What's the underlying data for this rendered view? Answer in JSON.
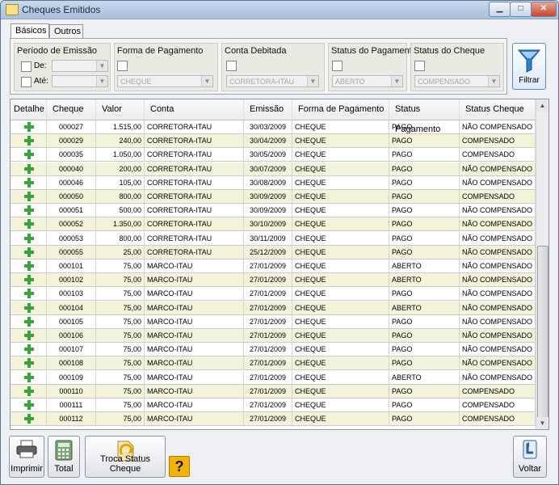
{
  "window": {
    "title": "Cheques Emitidos",
    "minimize": "▁",
    "maximize": "□",
    "close": "✕"
  },
  "tabs": [
    {
      "label": "Básicos"
    },
    {
      "label": "Outros"
    }
  ],
  "filters": {
    "periodo": {
      "label": "Período de Emissão",
      "de_label": "De:",
      "ate_label": "Até:"
    },
    "forma": {
      "label": "Forma de Pagamento",
      "value": "CHEQUE"
    },
    "conta": {
      "label": "Conta Debitada",
      "value": "CORRETORA-ITAU"
    },
    "status_pagamento": {
      "label": "Status do Pagamento",
      "value": "ABERTO"
    },
    "status_cheque": {
      "label": "Status do Cheque",
      "value": "COMPENSADO"
    },
    "filtrar_label": "Filtrar",
    "filtrar_icon": "funnel-icon"
  },
  "grid": {
    "columns": [
      "Detalhe",
      "Cheque",
      "Valor",
      "Conta",
      "Emissão",
      "Forma de Pagamento",
      "Status Pagamento",
      "Status Cheque"
    ],
    "rows": [
      [
        "000027",
        "1.515,00",
        "CORRETORA-ITAU",
        "30/03/2009",
        "CHEQUE",
        "PAGO",
        "NÃO COMPENSADO"
      ],
      [
        "000029",
        "240,00",
        "CORRETORA-ITAU",
        "30/04/2009",
        "CHEQUE",
        "PAGO",
        "COMPENSADO"
      ],
      [
        "000035",
        "1.050,00",
        "CORRETORA-ITAU",
        "30/05/2009",
        "CHEQUE",
        "PAGO",
        "COMPENSADO"
      ],
      [
        "000040",
        "200,00",
        "CORRETORA-ITAU",
        "30/07/2009",
        "CHEQUE",
        "PAGO",
        "NÃO COMPENSADO"
      ],
      [
        "000046",
        "105,00",
        "CORRETORA-ITAU",
        "30/08/2009",
        "CHEQUE",
        "PAGO",
        "NÃO COMPENSADO"
      ],
      [
        "000050",
        "800,00",
        "CORRETORA-ITAU",
        "30/09/2009",
        "CHEQUE",
        "PAGO",
        "COMPENSADO"
      ],
      [
        "000051",
        "500,00",
        "CORRETORA-ITAU",
        "30/09/2009",
        "CHEQUE",
        "PAGO",
        "NÃO COMPENSADO"
      ],
      [
        "000052",
        "1.350,00",
        "CORRETORA-ITAU",
        "30/10/2009",
        "CHEQUE",
        "PAGO",
        "NÃO COMPENSADO"
      ],
      [
        "000053",
        "800,00",
        "CORRETORA-ITAU",
        "30/11/2009",
        "CHEQUE",
        "PAGO",
        "NÃO COMPENSADO"
      ],
      [
        "000055",
        "25,00",
        "CORRETORA-ITAU",
        "25/12/2009",
        "CHEQUE",
        "PAGO",
        "NÃO COMPENSADO"
      ],
      [
        "000101",
        "75,00",
        "MARCO-ITAU",
        "27/01/2009",
        "CHEQUE",
        "ABERTO",
        "NÃO COMPENSADO"
      ],
      [
        "000102",
        "75,00",
        "MARCO-ITAU",
        "27/01/2009",
        "CHEQUE",
        "ABERTO",
        "NÃO COMPENSADO"
      ],
      [
        "000103",
        "75,00",
        "MARCO-ITAU",
        "27/01/2009",
        "CHEQUE",
        "PAGO",
        "NÃO COMPENSADO"
      ],
      [
        "000104",
        "75,00",
        "MARCO-ITAU",
        "27/01/2009",
        "CHEQUE",
        "ABERTO",
        "NÃO COMPENSADO"
      ],
      [
        "000105",
        "75,00",
        "MARCO-ITAU",
        "27/01/2009",
        "CHEQUE",
        "PAGO",
        "NÃO COMPENSADO"
      ],
      [
        "000106",
        "75,00",
        "MARCO-ITAU",
        "27/01/2009",
        "CHEQUE",
        "PAGO",
        "NÃO COMPENSADO"
      ],
      [
        "000107",
        "75,00",
        "MARCO-ITAU",
        "27/01/2009",
        "CHEQUE",
        "PAGO",
        "NÃO COMPENSADO"
      ],
      [
        "000108",
        "75,00",
        "MARCO-ITAU",
        "27/01/2009",
        "CHEQUE",
        "PAGO",
        "NÃO COMPENSADO"
      ],
      [
        "000109",
        "75,00",
        "MARCO-ITAU",
        "27/01/2009",
        "CHEQUE",
        "ABERTO",
        "NÃO COMPENSADO"
      ],
      [
        "000110",
        "75,00",
        "MARCO-ITAU",
        "27/01/2009",
        "CHEQUE",
        "PAGO",
        "COMPENSADO"
      ],
      [
        "000111",
        "75,00",
        "MARCO-ITAU",
        "27/01/2009",
        "CHEQUE",
        "PAGO",
        "COMPENSADO"
      ],
      [
        "000112",
        "75,00",
        "MARCO-ITAU",
        "27/01/2009",
        "CHEQUE",
        "PAGO",
        "COMPENSADO"
      ]
    ]
  },
  "bottom": {
    "imprimir": {
      "label": "Imprimir",
      "icon": "printer-icon"
    },
    "total": {
      "label": "Total",
      "icon": "calculator-icon"
    },
    "troca": {
      "label": "Troca Status Cheque",
      "icon": "exchange-document-icon"
    },
    "help": {
      "label": "?",
      "icon": "help-icon"
    },
    "voltar": {
      "label": "Voltar",
      "icon": "back-arrow-icon"
    }
  },
  "colors": {
    "row_alt": "#f3f3d9",
    "plus": "#3aa33a",
    "help": "#f2b400"
  }
}
